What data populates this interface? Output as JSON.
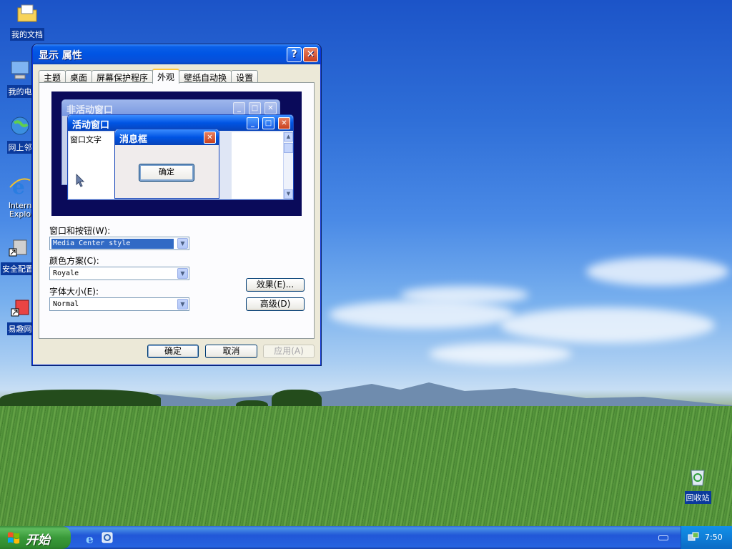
{
  "desktop": {
    "icons": [
      {
        "label": "我的文档"
      },
      {
        "label": "我的电"
      },
      {
        "label": "网上邻"
      },
      {
        "label": "Intern\nExplo"
      },
      {
        "label": "安全配置"
      },
      {
        "label": "易趣网"
      },
      {
        "label": "回收站"
      }
    ]
  },
  "dialog": {
    "title": "显示 属性",
    "help_glyph": "?",
    "close_glyph": "✕",
    "tabs": [
      "主题",
      "桌面",
      "屏幕保护程序",
      "外观",
      "壁纸自动换",
      "设置"
    ],
    "active_tab": "外观",
    "preview": {
      "inactive_title": "非活动窗口",
      "active_title": "活动窗口",
      "window_text": "窗口文字",
      "message_title": "消息框",
      "message_ok": "确定"
    },
    "fields": {
      "style_label": "窗口和按钮(W):",
      "style_value": "Media Center style",
      "scheme_label": "颜色方案(C):",
      "scheme_value": "Royale",
      "font_label": "字体大小(E):",
      "font_value": "Normal"
    },
    "effects_button": "效果(E)...",
    "advanced_button": "高级(D)",
    "ok_button": "确定",
    "cancel_button": "取消",
    "apply_button": "应用(A)"
  },
  "taskbar": {
    "start_label": "开始",
    "clock": "7:50"
  }
}
